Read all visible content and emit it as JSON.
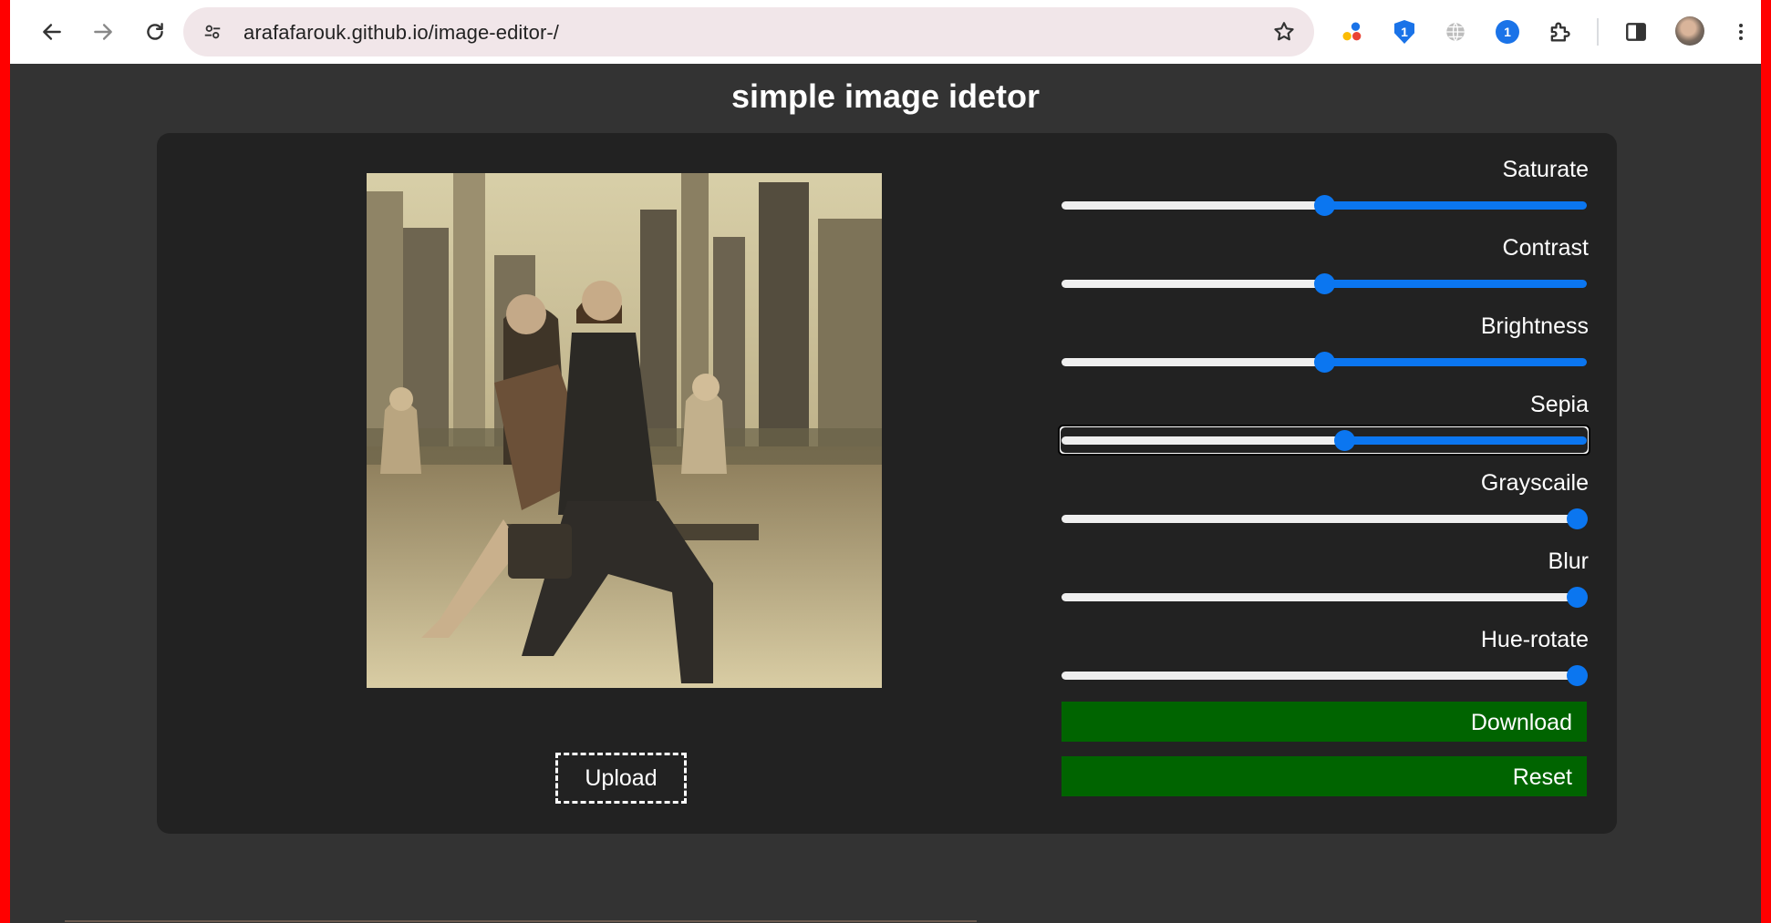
{
  "browser": {
    "url": "arafafarouk.github.io/image-editor-/",
    "extension_badges": [
      "1",
      "1"
    ]
  },
  "page": {
    "title": "simple image idetor",
    "upload_label": "Upload"
  },
  "controls": [
    {
      "id": "saturate",
      "label": "Saturate",
      "fraction": 0.5
    },
    {
      "id": "contrast",
      "label": "Contrast",
      "fraction": 0.5
    },
    {
      "id": "brightness",
      "label": "Brightness",
      "fraction": 0.5
    },
    {
      "id": "sepia",
      "label": "Sepia",
      "fraction": 0.54,
      "focused": true
    },
    {
      "id": "grayscale",
      "label": "Grayscaile",
      "fraction": 1.0
    },
    {
      "id": "blur",
      "label": "Blur",
      "fraction": 1.0
    },
    {
      "id": "hue-rotate",
      "label": "Hue-rotate",
      "fraction": 1.0
    }
  ],
  "actions": {
    "download_label": "Download",
    "reset_label": "Reset"
  },
  "colors": {
    "slider_accent": "#0b76f0",
    "button_bg": "#006400",
    "panel_bg": "#222222",
    "page_bg": "#333333"
  }
}
